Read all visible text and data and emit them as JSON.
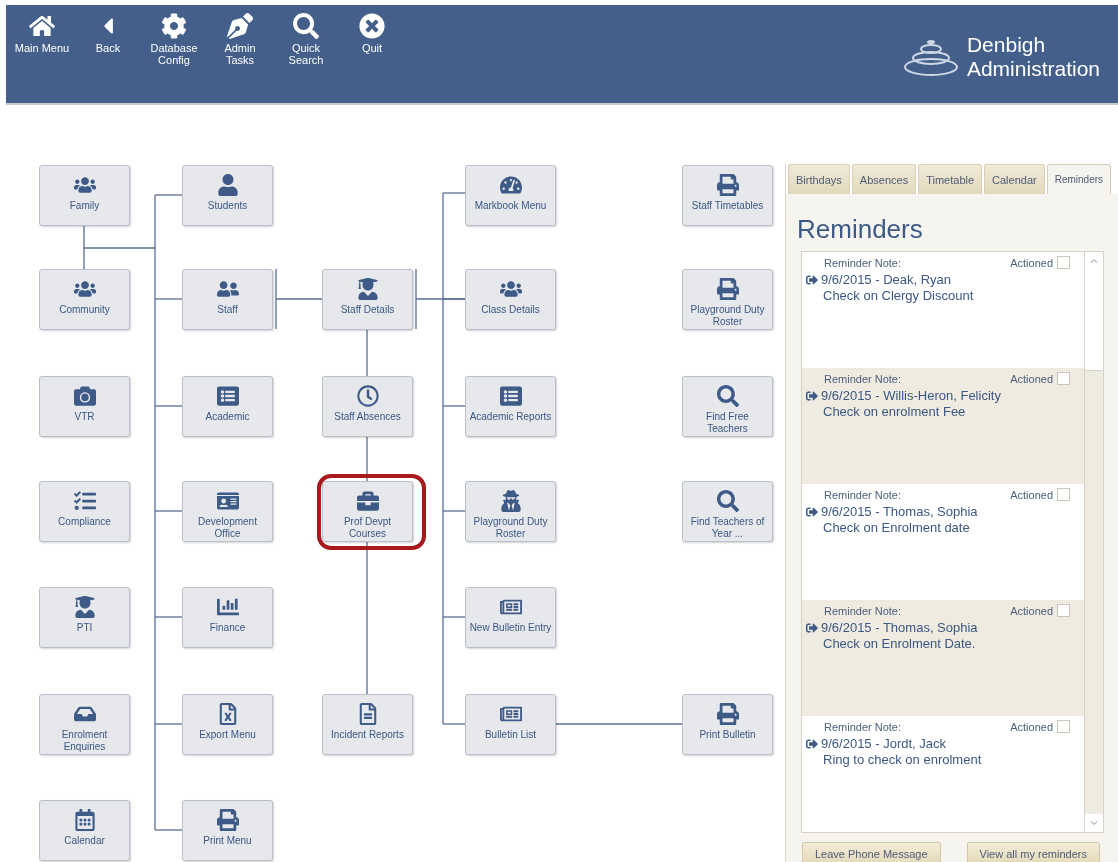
{
  "toolbar": [
    {
      "label": "Main Menu"
    },
    {
      "label": "Back"
    },
    {
      "label": "Database Config"
    },
    {
      "label": "Admin Tasks"
    },
    {
      "label": "Quick Search"
    },
    {
      "label": "Quit"
    }
  ],
  "brand": {
    "line_1": "Denbigh",
    "line_2": "Administration"
  },
  "tiles": [
    {
      "label": "Family",
      "highlighted": false
    },
    {
      "label": "Students",
      "highlighted": false
    },
    {
      "label": "Markbook Menu",
      "highlighted": false
    },
    {
      "label": "Staff Timetables",
      "highlighted": false
    },
    {
      "label": "Community",
      "highlighted": false
    },
    {
      "label": "Staff",
      "highlighted": false
    },
    {
      "label": "Staff Details",
      "highlighted": false
    },
    {
      "label": "Class Details",
      "highlighted": false
    },
    {
      "label": "Playground Duty Roster",
      "highlighted": false
    },
    {
      "label": "VTR",
      "highlighted": false
    },
    {
      "label": "Academic",
      "highlighted": false
    },
    {
      "label": "Staff Absences",
      "highlighted": false
    },
    {
      "label": "Academic Reports",
      "highlighted": false
    },
    {
      "label": "Find Free Teachers",
      "highlighted": false
    },
    {
      "label": "Compliance",
      "highlighted": false
    },
    {
      "label": "Development Office",
      "highlighted": false
    },
    {
      "label": "Prof Devpt Courses",
      "highlighted": true
    },
    {
      "label": "Playground Duty Roster",
      "highlighted": false
    },
    {
      "label": "Find Teachers of Year ...",
      "highlighted": false
    },
    {
      "label": "PTI",
      "highlighted": false
    },
    {
      "label": "Finance",
      "highlighted": false
    },
    {
      "label": "New Bulletin Entry",
      "highlighted": false
    },
    {
      "label": "Enrolment Enquiries",
      "highlighted": false
    },
    {
      "label": "Export Menu",
      "highlighted": false
    },
    {
      "label": "Incident Reports",
      "highlighted": false
    },
    {
      "label": "Bulletin List",
      "highlighted": false
    },
    {
      "label": "Print Bulletin",
      "highlighted": false
    },
    {
      "label": "Calendar",
      "highlighted": false
    },
    {
      "label": "Print Menu",
      "highlighted": false
    }
  ],
  "panel": {
    "tabs": [
      {
        "label": "Birthdays",
        "selected": false
      },
      {
        "label": "Absences",
        "selected": false
      },
      {
        "label": "Timetable",
        "selected": false
      },
      {
        "label": "Calendar",
        "selected": false
      },
      {
        "label": "Reminders",
        "selected": true
      }
    ],
    "title": "Reminders",
    "reminders": [
      {
        "heading": "Reminder Note:",
        "actioned_label": "Actioned",
        "actioned": false,
        "line": "9/6/2015 - Deak, Ryan",
        "note": "Check on Clergy Discount"
      },
      {
        "heading": "Reminder Note:",
        "actioned_label": "Actioned",
        "actioned": false,
        "line": "9/6/2015 - Willis-Heron, Felicity",
        "note": "Check on enrolment Fee"
      },
      {
        "heading": "Reminder Note:",
        "actioned_label": "Actioned",
        "actioned": false,
        "line": "9/6/2015 - Thomas, Sophia",
        "note": "Check on Enrolment date"
      },
      {
        "heading": "Reminder Note:",
        "actioned_label": "Actioned",
        "actioned": false,
        "line": "9/6/2015 - Thomas, Sophia",
        "note": "Check on Enrolment Date."
      },
      {
        "heading": "Reminder Note:",
        "actioned_label": "Actioned",
        "actioned": false,
        "line": "9/6/2015 - Jordt, Jack",
        "note": "Ring to check on enrolment"
      }
    ],
    "buttons": [
      "Leave Phone Message",
      "View all my reminders"
    ]
  }
}
